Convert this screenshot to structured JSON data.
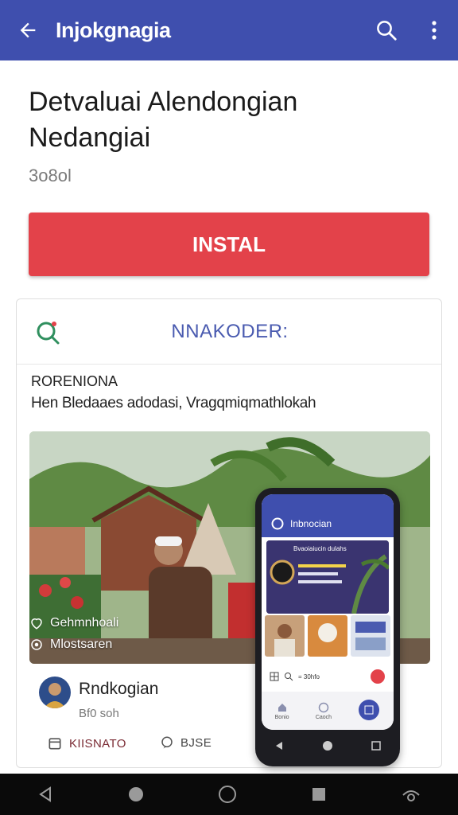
{
  "appbar": {
    "title": "Injokgnagia",
    "back_icon": "arrow-left-icon",
    "search_icon": "search-icon",
    "menu_icon": "more-vertical-icon",
    "color": "#3f4fae"
  },
  "app": {
    "title_line1": "Detvaluai Alendongian",
    "title_line2": "Nedangiai",
    "subtitle": "3o8ol"
  },
  "install": {
    "label": "INSTAL",
    "color": "#e3424a"
  },
  "card": {
    "header_title": "NNAKODER:",
    "section_label": "RORENIONA",
    "description": "Hen Bledaaes adodasi, Vragqmiqmathlokah",
    "overlay_line1": "Gehmnhoali",
    "overlay_line2": "Mlostsaren",
    "author_name": "Rndkogian",
    "author_meta": "Bf0 soh",
    "action1": "KIISNATO",
    "action2": "BJSE"
  },
  "phone": {
    "app_title": "Inbnocian",
    "banner_title": "Bvaoiaiucin dulahs",
    "row_text": "= 30hfo",
    "nav1": "Bonio",
    "nav2": "Caoch"
  },
  "system_nav": {
    "back": "triangle-back-icon",
    "home": "circle-home-icon",
    "recent": "square-recent-icon"
  }
}
